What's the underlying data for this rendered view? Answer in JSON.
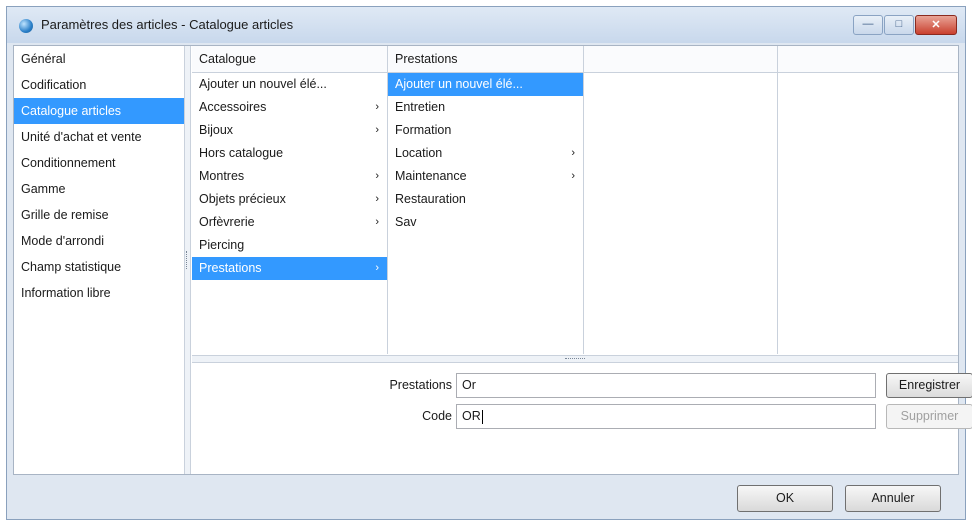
{
  "window": {
    "title": "Paramètres des articles -  Catalogue articles",
    "min_glyph": "—",
    "max_glyph": "□",
    "close_glyph": "✕"
  },
  "sidebar": {
    "items": [
      {
        "label": "Général"
      },
      {
        "label": "Codification"
      },
      {
        "label": "Catalogue articles",
        "selected": true
      },
      {
        "label": "Unité d'achat et vente"
      },
      {
        "label": "Conditionnement"
      },
      {
        "label": "Gamme"
      },
      {
        "label": "Grille de remise"
      },
      {
        "label": "Mode d'arrondi"
      },
      {
        "label": "Champ statistique"
      },
      {
        "label": "Information libre"
      }
    ]
  },
  "columns": {
    "catalogue": {
      "header": "Catalogue",
      "rows": [
        {
          "label": "Ajouter un nouvel élé...",
          "arrow": ""
        },
        {
          "label": "Accessoires",
          "arrow": "›"
        },
        {
          "label": "Bijoux",
          "arrow": "›"
        },
        {
          "label": "Hors catalogue",
          "arrow": ""
        },
        {
          "label": "Montres",
          "arrow": "›"
        },
        {
          "label": "Objets précieux",
          "arrow": "›"
        },
        {
          "label": "Orfèvrerie",
          "arrow": "›"
        },
        {
          "label": "Piercing",
          "arrow": ""
        },
        {
          "label": "Prestations",
          "arrow": "›",
          "selected": true
        }
      ]
    },
    "prestations": {
      "header": "Prestations",
      "rows": [
        {
          "label": "Ajouter un nouvel élé...",
          "arrow": "",
          "selected": true
        },
        {
          "label": "Entretien",
          "arrow": ""
        },
        {
          "label": "Formation",
          "arrow": ""
        },
        {
          "label": "Location",
          "arrow": "›"
        },
        {
          "label": "Maintenance",
          "arrow": "›"
        },
        {
          "label": "Restauration",
          "arrow": ""
        },
        {
          "label": "Sav",
          "arrow": ""
        }
      ]
    }
  },
  "form": {
    "prestations_label": "Prestations",
    "prestations_value": "Or",
    "code_label": "Code",
    "code_value": "OR",
    "save_label": "Enregistrer",
    "delete_label": "Supprimer"
  },
  "footer": {
    "ok_label": "OK",
    "cancel_label": "Annuler"
  },
  "colors": {
    "selection": "#3399ff",
    "title_bar": "#c8d8ec",
    "close_button": "#c9402e"
  }
}
